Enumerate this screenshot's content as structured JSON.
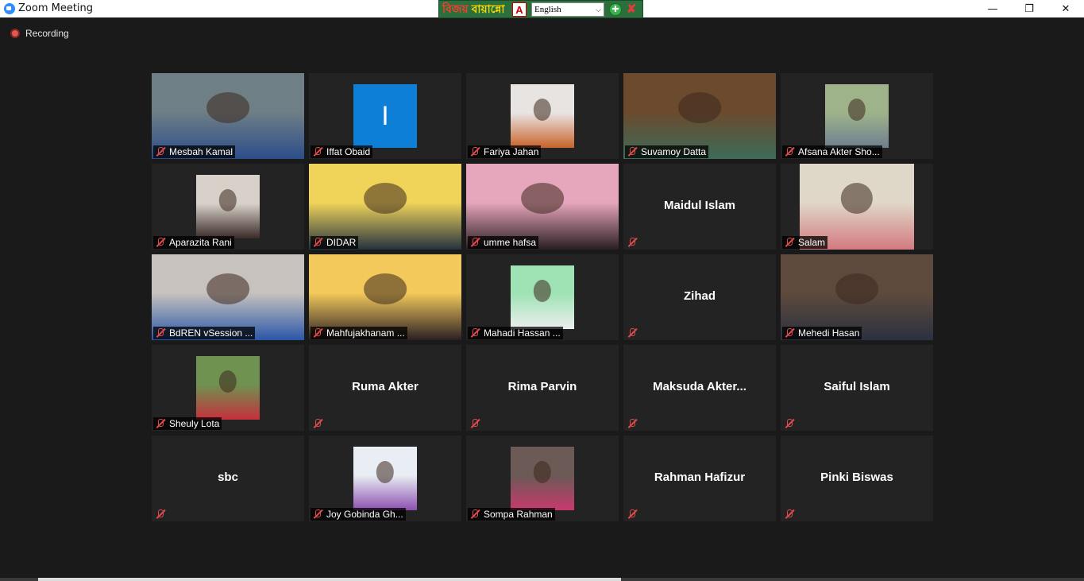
{
  "window": {
    "title": "Zoom Meeting",
    "minimize": "—",
    "restore": "❐",
    "close": "✕"
  },
  "ime": {
    "logo": "বিজয়",
    "name": "বায়ান্নো",
    "a_icon": "A",
    "language": "English",
    "dropdown_arrow": "⌵",
    "green_icon": "✚",
    "close_icon": "✘"
  },
  "recording": {
    "label": "Recording"
  },
  "participants": [
    {
      "name": "Mesbah Kamal",
      "video": true,
      "bg": "#6f7f86",
      "fg": "#2c4d8a"
    },
    {
      "name": "Iffat Obaid",
      "video": false,
      "initial": "I",
      "initial_bg": "#0e7fd6"
    },
    {
      "name": "Fariya Jahan",
      "video": true,
      "bg": "#e8e4e2",
      "fg": "#c8632a"
    },
    {
      "name": "Suvamoy Datta",
      "video": true,
      "bg": "#6b4a2e",
      "fg": "#3d6b58"
    },
    {
      "name": "Afsana Akter Sho...",
      "video": true,
      "bg": "#9eb38a",
      "fg": "#6e7f8f"
    },
    {
      "name": "Aparazita Rani",
      "video": true,
      "bg": "#d8d1c9",
      "fg": "#3a2a28"
    },
    {
      "name": "DIDAR",
      "video": true,
      "bg": "#f0d45a",
      "fg": "#24323f"
    },
    {
      "name": "umme hafsa",
      "video": true,
      "bg": "#e6a6bb",
      "fg": "#2a1e22"
    },
    {
      "name": "Maidul Islam",
      "video": false
    },
    {
      "name": "Salam",
      "video": true,
      "bg": "#dfd8c9",
      "fg": "#d47a80"
    },
    {
      "name": "BdREN vSession ...",
      "video": true,
      "bg": "#c7c2be",
      "fg": "#2a57a8"
    },
    {
      "name": "Mahfujakhanam ...",
      "video": true,
      "bg": "#f2c95a",
      "fg": "#2a1f24"
    },
    {
      "name": "Mahadi Hassan ...",
      "video": true,
      "bg": "#9fe3b4",
      "fg": "#eeeeee"
    },
    {
      "name": "Zihad",
      "video": false
    },
    {
      "name": "Mehedi Hasan",
      "video": true,
      "bg": "#5e4a3d",
      "fg": "#2b3140"
    },
    {
      "name": "Sheuly Lota",
      "video": true,
      "bg": "#6f9250",
      "fg": "#c5303c"
    },
    {
      "name": "Ruma Akter",
      "video": false
    },
    {
      "name": "Rima Parvin",
      "video": false
    },
    {
      "name": "Maksuda  Akter...",
      "video": false
    },
    {
      "name": "Saiful Islam",
      "video": false
    },
    {
      "name": "sbc",
      "video": false
    },
    {
      "name": "Joy Gobinda Gh...",
      "video": true,
      "bg": "#e8eef3",
      "fg": "#8c4fb0"
    },
    {
      "name": "Sompa Rahman",
      "video": true,
      "bg": "#6b5a56",
      "fg": "#c83a6e"
    },
    {
      "name": "Rahman Hafizur",
      "video": false
    },
    {
      "name": "Pinki Biswas",
      "video": false
    }
  ]
}
